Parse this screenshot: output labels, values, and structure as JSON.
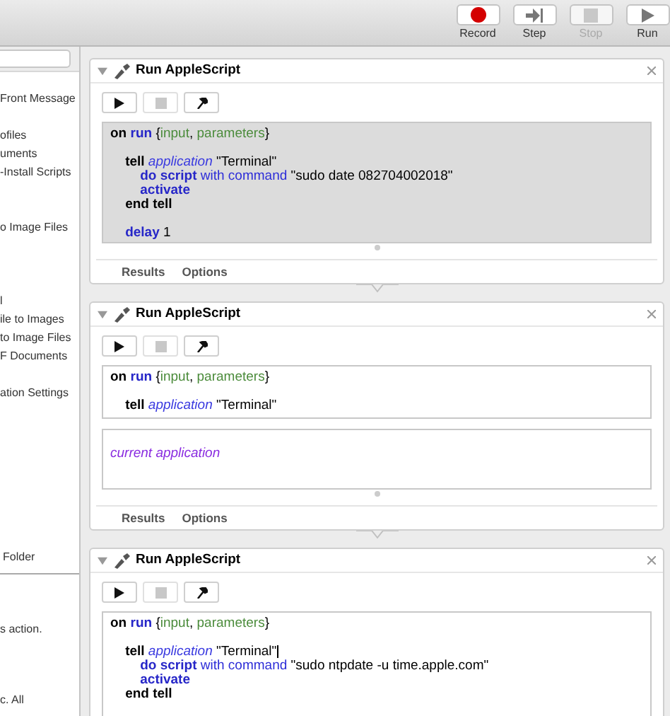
{
  "toolbar": {
    "buttons": [
      {
        "label": "Record",
        "kind": "record",
        "disabled": false
      },
      {
        "label": "Step",
        "kind": "step",
        "disabled": false
      },
      {
        "label": "Stop",
        "kind": "stop",
        "disabled": true
      },
      {
        "label": "Run",
        "kind": "run",
        "disabled": false
      }
    ]
  },
  "sidebar": {
    "groups": [
      [
        "Front Message"
      ],
      [
        "ofiles",
        "uments",
        "-Install Scripts"
      ],
      [
        "o Image Files"
      ],
      [
        "l",
        "ile to Images",
        "to Image Files",
        "F Documents"
      ],
      [
        "ation Settings"
      ]
    ],
    "section_label": "Folder",
    "description": [
      "s action.",
      "c. All"
    ]
  },
  "actions": [
    {
      "title": "Run AppleScript",
      "expanded": true,
      "tabs": [
        "Results",
        "Options"
      ],
      "editor": {
        "dimmed": true,
        "lines": [
          {
            "gap_before": false,
            "tokens": [
              {
                "text": "on",
                "kind": "keyword"
              },
              {
                "text": " run",
                "kind": "handler"
              },
              {
                "text": " {",
                "kind": "text"
              },
              {
                "text": "input",
                "kind": "param"
              },
              {
                "text": ", ",
                "kind": "text"
              },
              {
                "text": "parameters",
                "kind": "param"
              },
              {
                "text": "}",
                "kind": "text"
              }
            ]
          },
          {
            "gap_before": true,
            "tokens": [
              {
                "text": "\ttell",
                "kind": "keyword"
              },
              {
                "text": " application",
                "kind": "class"
              },
              {
                "text": " \"Terminal\"",
                "kind": "text"
              }
            ]
          },
          {
            "gap_before": false,
            "tokens": [
              {
                "text": "\t\tdo script",
                "kind": "command"
              },
              {
                "text": " with command",
                "kind": "property"
              },
              {
                "text": " \"sudo date 082704002018\"",
                "kind": "text"
              }
            ]
          },
          {
            "gap_before": false,
            "tokens": [
              {
                "text": "\t\tactivate",
                "kind": "command"
              }
            ]
          },
          {
            "gap_before": false,
            "tokens": [
              {
                "text": "\tend tell",
                "kind": "keyword"
              }
            ]
          },
          {
            "gap_before": true,
            "tokens": [
              {
                "text": "\tdelay",
                "kind": "command"
              },
              {
                "text": " 1",
                "kind": "text"
              }
            ]
          }
        ]
      }
    },
    {
      "title": "Run AppleScript",
      "expanded": true,
      "tabs": [
        "Results",
        "Options"
      ],
      "editor": {
        "dimmed": false,
        "lines": [
          {
            "gap_before": false,
            "tokens": [
              {
                "text": "on",
                "kind": "keyword"
              },
              {
                "text": " run",
                "kind": "handler"
              },
              {
                "text": " {",
                "kind": "text"
              },
              {
                "text": "input",
                "kind": "param"
              },
              {
                "text": ", ",
                "kind": "text"
              },
              {
                "text": "parameters",
                "kind": "param"
              },
              {
                "text": "}",
                "kind": "text"
              }
            ]
          },
          {
            "gap_before": true,
            "tokens": [
              {
                "text": "\ttell",
                "kind": "keyword"
              },
              {
                "text": " application",
                "kind": "class"
              },
              {
                "text": " \"Terminal\"",
                "kind": "text"
              }
            ]
          }
        ]
      },
      "result": "current application"
    },
    {
      "title": "Run AppleScript",
      "expanded": true,
      "editor": {
        "dimmed": false,
        "lines": [
          {
            "gap_before": false,
            "tokens": [
              {
                "text": "on",
                "kind": "keyword"
              },
              {
                "text": " run",
                "kind": "handler"
              },
              {
                "text": " {",
                "kind": "text"
              },
              {
                "text": "input",
                "kind": "param"
              },
              {
                "text": ", ",
                "kind": "text"
              },
              {
                "text": "parameters",
                "kind": "param"
              },
              {
                "text": "}",
                "kind": "text"
              }
            ]
          },
          {
            "gap_before": true,
            "tokens": [
              {
                "text": "\ttell",
                "kind": "keyword"
              },
              {
                "text": " application",
                "kind": "class"
              },
              {
                "text": " \"Terminal\"",
                "kind": "text",
                "caret": true
              }
            ]
          },
          {
            "gap_before": false,
            "tokens": [
              {
                "text": "\t\tdo script",
                "kind": "command"
              },
              {
                "text": " with command",
                "kind": "property"
              },
              {
                "text": " \"sudo ntpdate -u time.apple.com\"",
                "kind": "text"
              }
            ]
          },
          {
            "gap_before": false,
            "tokens": [
              {
                "text": "\t\tactivate",
                "kind": "command"
              }
            ]
          },
          {
            "gap_before": false,
            "tokens": [
              {
                "text": "\tend tell",
                "kind": "keyword"
              }
            ]
          }
        ]
      }
    }
  ]
}
